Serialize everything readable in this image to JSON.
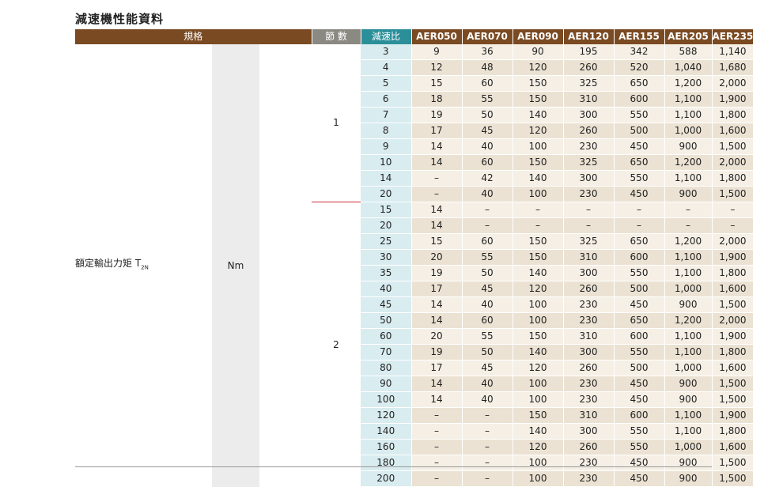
{
  "title": "減速機性能資料",
  "headers": {
    "spec": "規格",
    "stage": "節 數",
    "ratio": "減速比",
    "models": [
      "AER050",
      "AER070",
      "AER090",
      "AER120",
      "AER155",
      "AER205",
      "AER235"
    ]
  },
  "row_label": "額定輸出力矩 T",
  "row_label_sub": "2N",
  "unit": "Nm",
  "stages": [
    {
      "stage": "1",
      "rows": [
        {
          "ratio": "3",
          "values": [
            "9",
            "36",
            "90",
            "195",
            "342",
            "588",
            "1,140"
          ]
        },
        {
          "ratio": "4",
          "values": [
            "12",
            "48",
            "120",
            "260",
            "520",
            "1,040",
            "1,680"
          ]
        },
        {
          "ratio": "5",
          "values": [
            "15",
            "60",
            "150",
            "325",
            "650",
            "1,200",
            "2,000"
          ]
        },
        {
          "ratio": "6",
          "values": [
            "18",
            "55",
            "150",
            "310",
            "600",
            "1,100",
            "1,900"
          ]
        },
        {
          "ratio": "7",
          "values": [
            "19",
            "50",
            "140",
            "300",
            "550",
            "1,100",
            "1,800"
          ]
        },
        {
          "ratio": "8",
          "values": [
            "17",
            "45",
            "120",
            "260",
            "500",
            "1,000",
            "1,600"
          ]
        },
        {
          "ratio": "9",
          "values": [
            "14",
            "40",
            "100",
            "230",
            "450",
            "900",
            "1,500"
          ]
        },
        {
          "ratio": "10",
          "values": [
            "14",
            "60",
            "150",
            "325",
            "650",
            "1,200",
            "2,000"
          ]
        },
        {
          "ratio": "14",
          "values": [
            "–",
            "42",
            "140",
            "300",
            "550",
            "1,100",
            "1,800"
          ]
        },
        {
          "ratio": "20",
          "values": [
            "–",
            "40",
            "100",
            "230",
            "450",
            "900",
            "1,500"
          ]
        }
      ]
    },
    {
      "stage": "2",
      "rows": [
        {
          "ratio": "15",
          "values": [
            "14",
            "–",
            "–",
            "–",
            "–",
            "–",
            "–"
          ]
        },
        {
          "ratio": "20",
          "values": [
            "14",
            "–",
            "–",
            "–",
            "–",
            "–",
            "–"
          ]
        },
        {
          "ratio": "25",
          "values": [
            "15",
            "60",
            "150",
            "325",
            "650",
            "1,200",
            "2,000"
          ]
        },
        {
          "ratio": "30",
          "values": [
            "20",
            "55",
            "150",
            "310",
            "600",
            "1,100",
            "1,900"
          ]
        },
        {
          "ratio": "35",
          "values": [
            "19",
            "50",
            "140",
            "300",
            "550",
            "1,100",
            "1,800"
          ]
        },
        {
          "ratio": "40",
          "values": [
            "17",
            "45",
            "120",
            "260",
            "500",
            "1,000",
            "1,600"
          ]
        },
        {
          "ratio": "45",
          "values": [
            "14",
            "40",
            "100",
            "230",
            "450",
            "900",
            "1,500"
          ]
        },
        {
          "ratio": "50",
          "values": [
            "14",
            "60",
            "100",
            "230",
            "650",
            "1,200",
            "2,000"
          ]
        },
        {
          "ratio": "60",
          "values": [
            "20",
            "55",
            "150",
            "310",
            "600",
            "1,100",
            "1,900"
          ]
        },
        {
          "ratio": "70",
          "values": [
            "19",
            "50",
            "140",
            "300",
            "550",
            "1,100",
            "1,800"
          ]
        },
        {
          "ratio": "80",
          "values": [
            "17",
            "45",
            "120",
            "260",
            "500",
            "1,000",
            "1,600"
          ]
        },
        {
          "ratio": "90",
          "values": [
            "14",
            "40",
            "100",
            "230",
            "450",
            "900",
            "1,500"
          ]
        },
        {
          "ratio": "100",
          "values": [
            "14",
            "40",
            "100",
            "230",
            "450",
            "900",
            "1,500"
          ]
        },
        {
          "ratio": "120",
          "values": [
            "–",
            "–",
            "150",
            "310",
            "600",
            "1,100",
            "1,900"
          ]
        },
        {
          "ratio": "140",
          "values": [
            "–",
            "–",
            "140",
            "300",
            "550",
            "1,100",
            "1,800"
          ]
        },
        {
          "ratio": "160",
          "values": [
            "–",
            "–",
            "120",
            "260",
            "550",
            "1,000",
            "1,600"
          ]
        },
        {
          "ratio": "180",
          "values": [
            "–",
            "–",
            "100",
            "230",
            "450",
            "900",
            "1,500"
          ]
        },
        {
          "ratio": "200",
          "values": [
            "–",
            "–",
            "100",
            "230",
            "450",
            "900",
            "1,500"
          ]
        }
      ]
    }
  ]
}
